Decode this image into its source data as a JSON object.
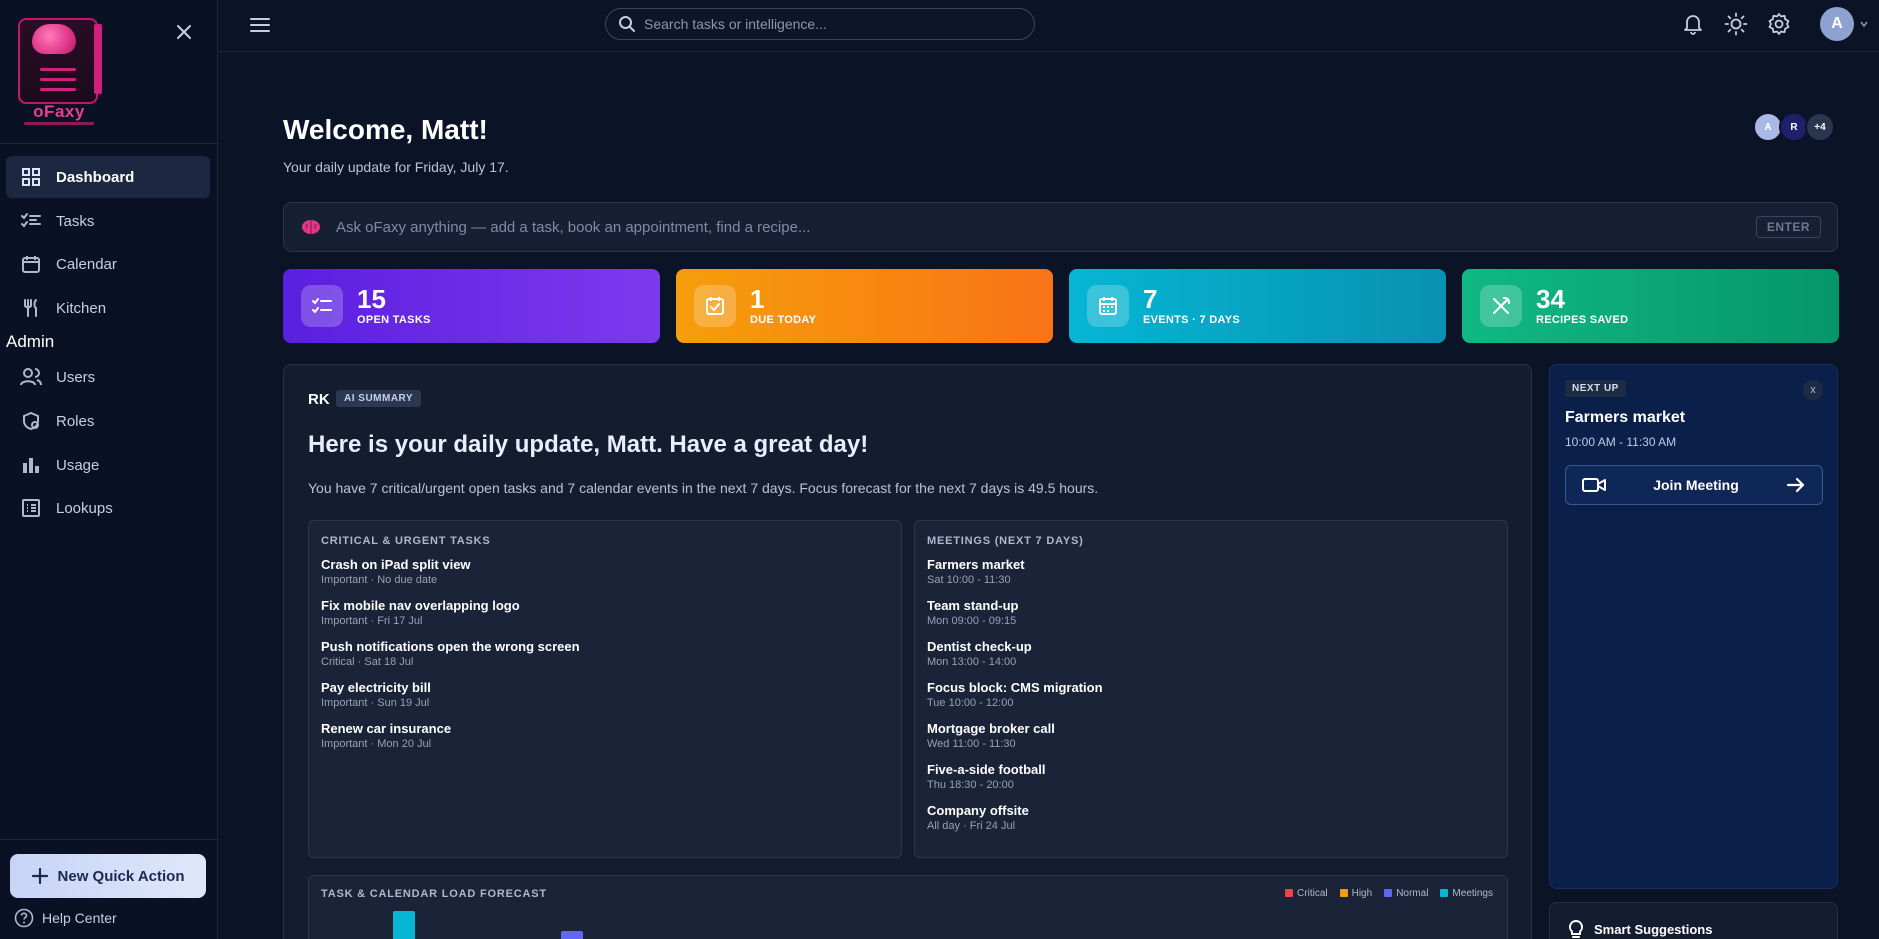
{
  "app": {
    "name": "oFaxy"
  },
  "sidebar": {
    "items": [
      {
        "label": "Dashboard",
        "icon": "grid-icon"
      },
      {
        "label": "Tasks",
        "icon": "checklist-icon"
      },
      {
        "label": "Calendar",
        "icon": "calendar-icon"
      },
      {
        "label": "Kitchen",
        "icon": "utensils-icon"
      }
    ],
    "section_label": "Admin",
    "admin_items": [
      {
        "label": "Users",
        "icon": "users-icon"
      },
      {
        "label": "Roles",
        "icon": "shield-user-icon"
      },
      {
        "label": "Usage",
        "icon": "bar-chart-icon"
      },
      {
        "label": "Lookups",
        "icon": "list-icon"
      }
    ],
    "quick_action": "New Quick Action",
    "help": "Help Center"
  },
  "topbar": {
    "search_placeholder": "Search tasks or intelligence...",
    "avatar_initial": "A"
  },
  "main": {
    "welcome": "Welcome, Matt!",
    "subtitle": "Your daily update for Friday, July 17.",
    "presence": [
      {
        "initial": "A",
        "color": "#a9b9e6"
      },
      {
        "initial": "R",
        "color": "#1f1f6b"
      },
      {
        "initial": "+4",
        "color": "#2a3550"
      }
    ],
    "ask_placeholder": "Ask oFaxy anything — add a task, book an appointment, find a recipe...",
    "ask_key": "ENTER"
  },
  "stats": [
    {
      "value": "15",
      "label": "OPEN TASKS",
      "color_from": "#5b1fe0",
      "color_to": "#7c3aed"
    },
    {
      "value": "1",
      "label": "DUE TODAY",
      "color_from": "#f59e0b",
      "color_to": "#f97316"
    },
    {
      "value": "7",
      "label": "EVENTS · 7 DAYS",
      "color_from": "#06b6d4",
      "color_to": "#0891b2"
    },
    {
      "value": "34",
      "label": "RECIPES SAVED",
      "color_from": "#10b981",
      "color_to": "#059669"
    }
  ],
  "summary": {
    "initials": "RK",
    "badge": "AI SUMMARY",
    "title": "Here is your daily update, Matt. Have a great day!",
    "text": "You have 7 critical/urgent open tasks and 7 calendar events in the next 7 days. Focus forecast for the next 7 days is 49.5 hours.",
    "tasks_heading": "CRITICAL & URGENT TASKS",
    "tasks": [
      {
        "title": "Crash on iPad split view",
        "sub": "Important · No due date"
      },
      {
        "title": "Fix mobile nav overlapping logo",
        "sub": "Important · Fri 17 Jul"
      },
      {
        "title": "Push notifications open the wrong screen",
        "sub": "Critical · Sat 18 Jul"
      },
      {
        "title": "Pay electricity bill",
        "sub": "Important · Sun 19 Jul"
      },
      {
        "title": "Renew car insurance",
        "sub": "Important · Mon 20 Jul"
      }
    ],
    "meetings_heading": "MEETINGS (NEXT 7 DAYS)",
    "meetings": [
      {
        "title": "Farmers market",
        "sub": "Sat 10:00 - 11:30"
      },
      {
        "title": "Team stand-up",
        "sub": "Mon 09:00 - 09:15"
      },
      {
        "title": "Dentist check-up",
        "sub": "Mon 13:00 - 14:00"
      },
      {
        "title": "Focus block: CMS migration",
        "sub": "Tue 10:00 - 12:00"
      },
      {
        "title": "Mortgage broker call",
        "sub": "Wed 11:00 - 11:30"
      },
      {
        "title": "Five-a-side football",
        "sub": "Thu 18:30 - 20:00"
      },
      {
        "title": "Company offsite",
        "sub": "All day · Fri 24 Jul"
      }
    ],
    "forecast_title": "TASK & CALENDAR LOAD FORECAST",
    "legend": [
      {
        "label": "Critical",
        "color": "#ef4444"
      },
      {
        "label": "High",
        "color": "#f59e0b"
      },
      {
        "label": "Normal",
        "color": "#6366f1"
      },
      {
        "label": "Meetings",
        "color": "#06b6d4"
      }
    ]
  },
  "next_up": {
    "badge": "NEXT UP",
    "close": "x",
    "title": "Farmers market",
    "time": "10:00 AM - 11:30 AM",
    "join_label": "Join Meeting"
  },
  "smart": {
    "title": "Smart Suggestions"
  }
}
